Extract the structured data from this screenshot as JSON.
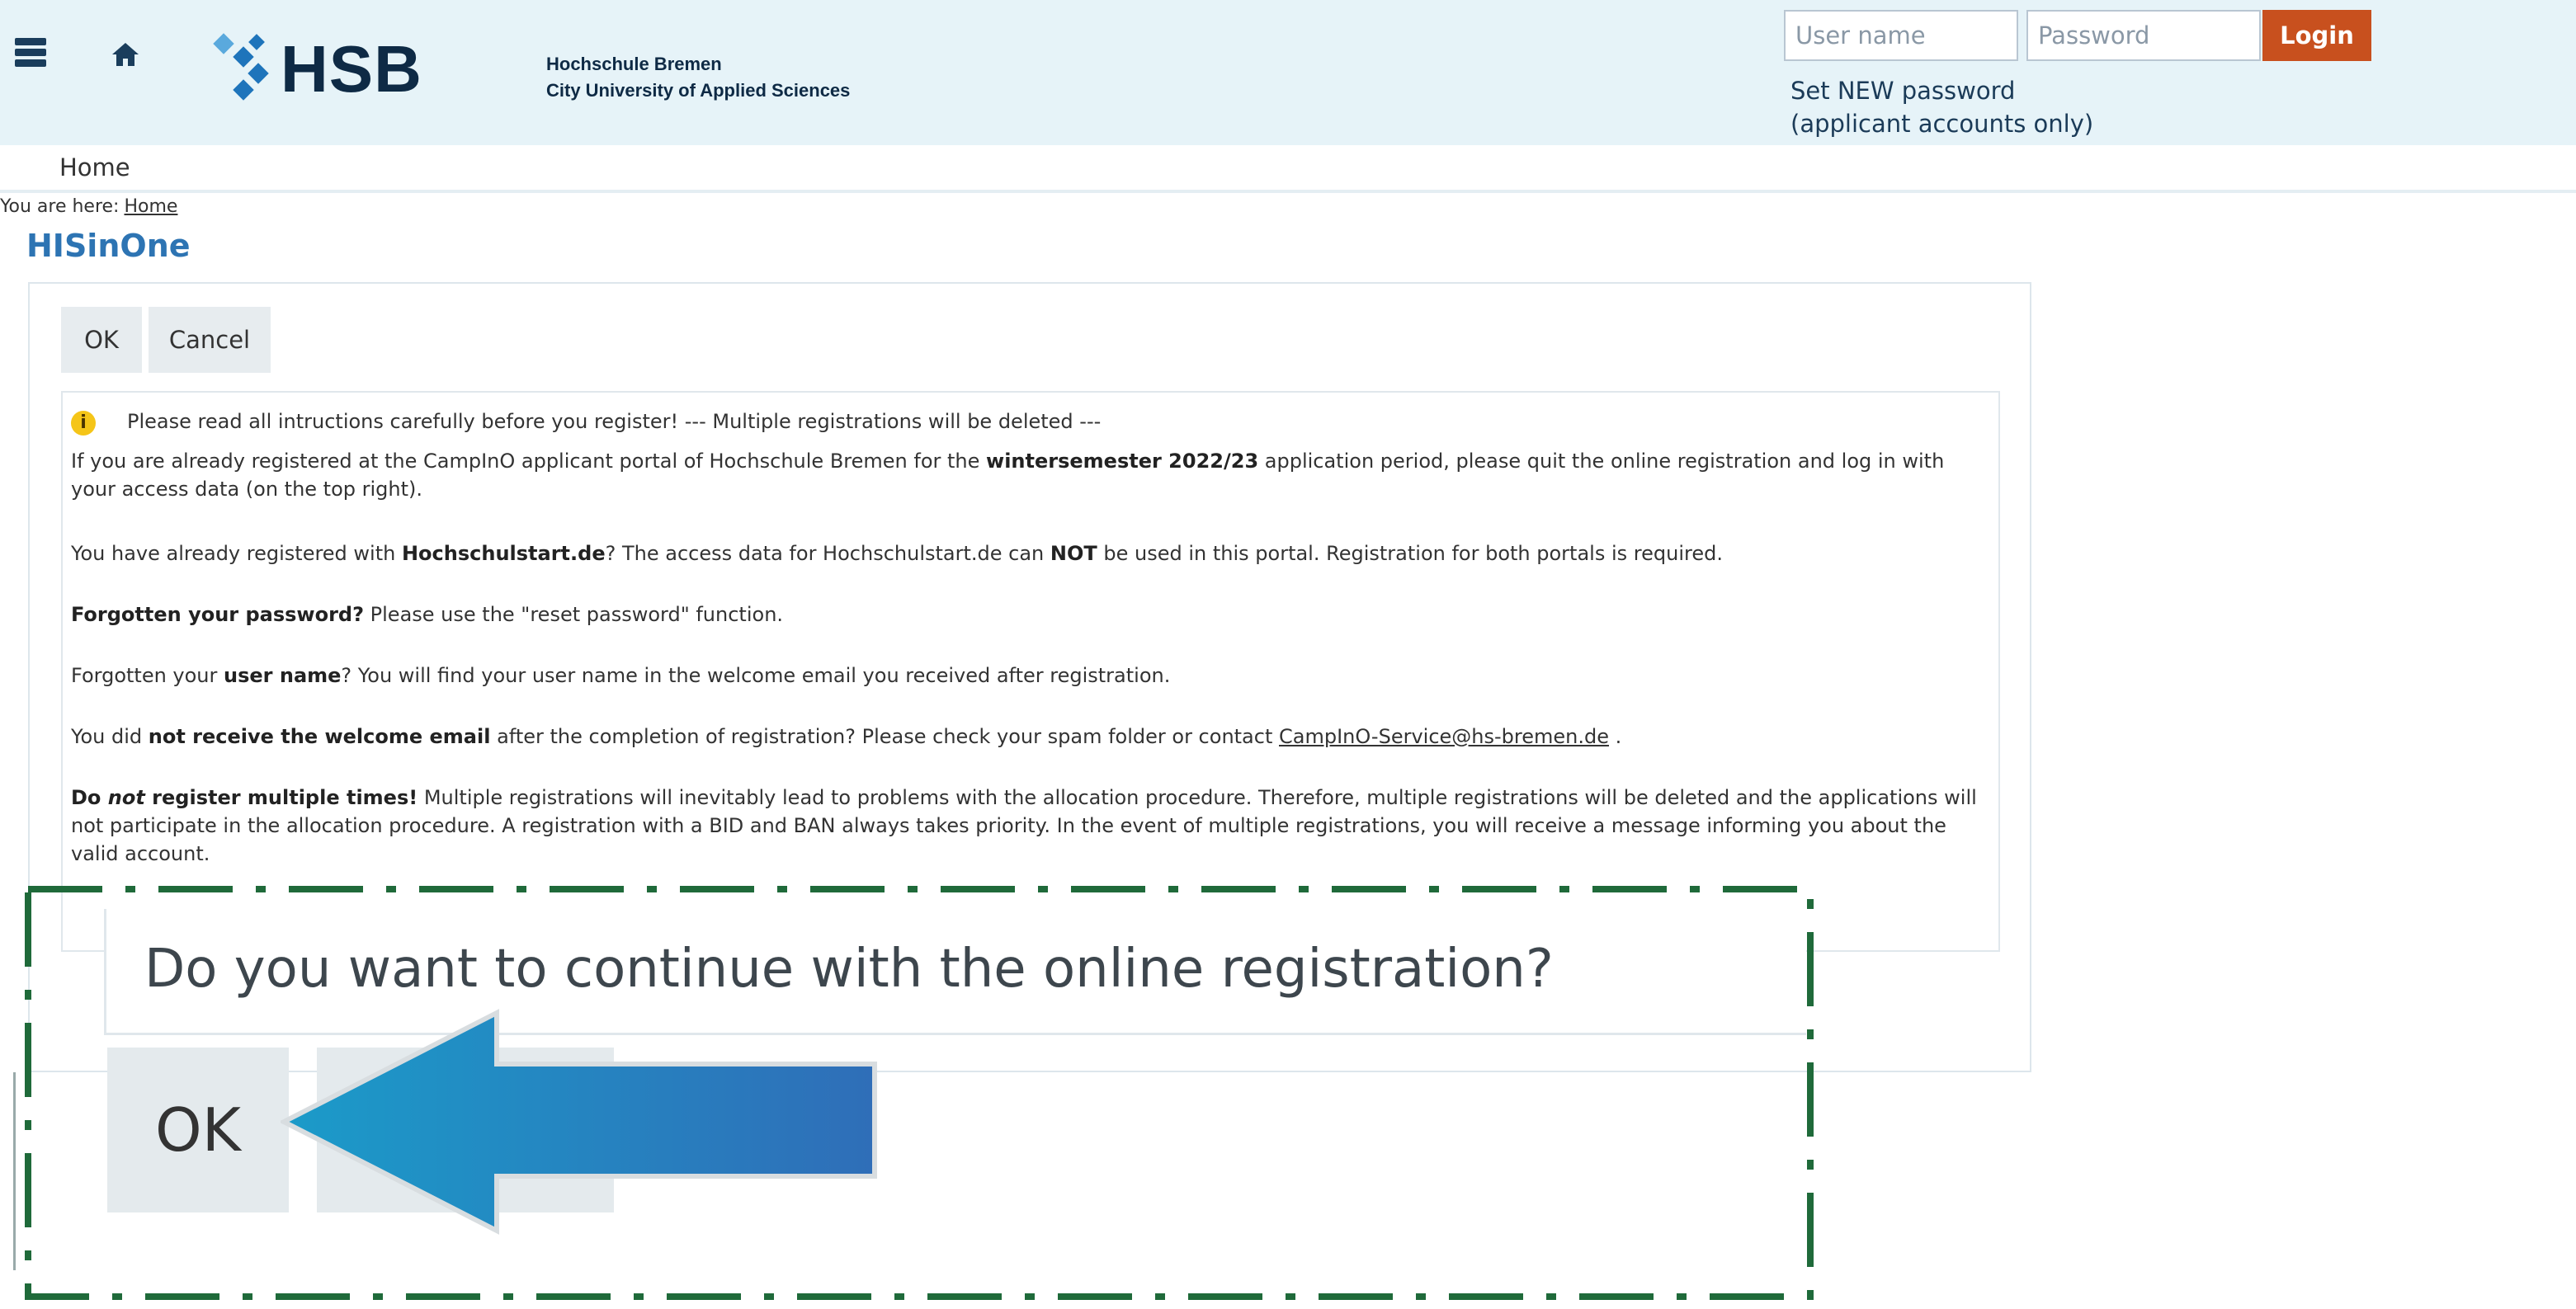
{
  "header": {
    "logo_text": "HSB",
    "uni_name_line1": "Hochschule Bremen",
    "uni_name_line2": "City University of Applied Sciences",
    "username_placeholder": "User name",
    "password_placeholder": "Password",
    "login_label": "Login",
    "new_password_line1": "Set NEW password",
    "new_password_line2": "(applicant accounts only)"
  },
  "nav": {
    "home": "Home"
  },
  "breadcrumb": {
    "prefix": "You are here:",
    "home": "Home"
  },
  "page_title": "HISinOne",
  "buttons": {
    "ok": "OK",
    "cancel": "Cancel"
  },
  "message": {
    "headline": "Please read all intructions carefully before you register! --- Multiple registrations will be deleted ---",
    "p1_a": "If you are already registered at the CampInO applicant portal of Hochschule Bremen for the ",
    "p1_b": "wintersemester 2022/23",
    "p1_c": " application period, please quit the online registration and log in with your access data (on the top right).",
    "p2_a": "You have already registered with ",
    "p2_b": "Hochschulstart.de",
    "p2_c": "? The access data for Hochschulstart.de can ",
    "p2_d": "NOT",
    "p2_e": " be used in this portal. Registration for both portals is required.",
    "p3_a": "Forgotten your password?",
    "p3_b": " Please use the \"reset password\" function.",
    "p4_a": "Forgotten your ",
    "p4_b": "user name",
    "p4_c": "? You will find your user name in the welcome email you received after registration.",
    "p5_a": "You did ",
    "p5_b": "not receive the welcome email",
    "p5_c": " after the completion of registration? Please check your spam folder or contact ",
    "p5_link": "CampInO-Service@hs-bremen.de",
    "p5_d": " .",
    "p6_a": "Do ",
    "p6_b": "not",
    "p6_c": " register multiple times!",
    "p6_d": " Multiple registrations will inevitably lead to problems with the allocation procedure. Therefore, multiple registrations will be deleted and the applications will not participate in the allocation procedure. A registration with a BID and BAN always takes priority. In the event of multiple registrations, you will receive a message informing you about the valid account."
  },
  "zoom": {
    "question": "Do you want to continue with the online registration?",
    "ok": "OK"
  },
  "colors": {
    "header_bg": "#e6f3f8",
    "login_button": "#c8501e",
    "title": "#2d74b3",
    "arrow": "#2a86c4",
    "dashed_frame": "#1f6a3a"
  }
}
